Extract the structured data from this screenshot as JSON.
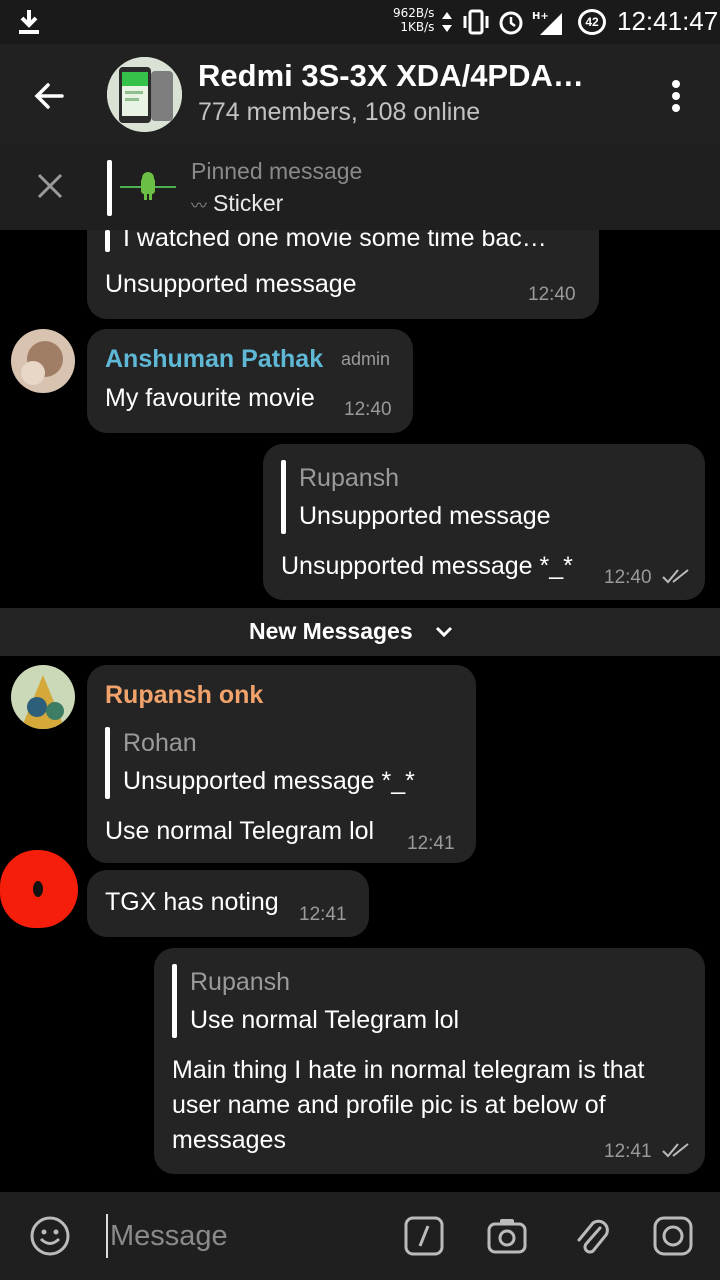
{
  "status_bar": {
    "net_speed_down": "962B/s",
    "net_speed_up": "1KB/s",
    "network": "H+",
    "battery": "42",
    "time": "12:41:47"
  },
  "header": {
    "title": "Redmi 3S-3X XDA/4PDA…",
    "subtitle": "774 members, 108 online"
  },
  "pinned": {
    "title": "Pinned message",
    "text": "Sticker"
  },
  "messages": [
    {
      "partial_reply_text": "I watched one movie some time bac…",
      "text": "Unsupported message",
      "time": "12:40"
    },
    {
      "sender": "Anshuman Pathak",
      "badge": "admin",
      "text": "My favourite movie",
      "time": "12:40",
      "sender_color": "#5fb8d6"
    },
    {
      "reply_name": "Rupansh",
      "reply_text": "Unsupported message",
      "text": "Unsupported message *_*",
      "time": "12:40"
    },
    {
      "sender": "Rupansh onk",
      "sender_color": "#f2a36b",
      "reply_name": "Rohan",
      "reply_text": "Unsupported message *_*",
      "text": "Use normal Telegram lol",
      "time": "12:41"
    },
    {
      "text": "TGX has noting",
      "time": "12:41"
    },
    {
      "reply_name": "Rupansh",
      "reply_text": "Use normal Telegram lol",
      "text_lines": [
        "Main thing I hate in normal telegram is that",
        "user name and profile pic is at below of",
        "messages"
      ],
      "time": "12:41"
    }
  ],
  "new_messages_label": "New Messages",
  "input": {
    "placeholder": "Message"
  },
  "icons": {
    "download": "download-icon",
    "back": "back-arrow-icon",
    "menu": "more-vert-icon",
    "close": "close-icon",
    "emoji": "emoji-icon",
    "commands": "slash-command-icon",
    "camera": "camera-icon",
    "attach": "paperclip-icon",
    "record": "video-message-icon",
    "read": "double-check-icon"
  }
}
